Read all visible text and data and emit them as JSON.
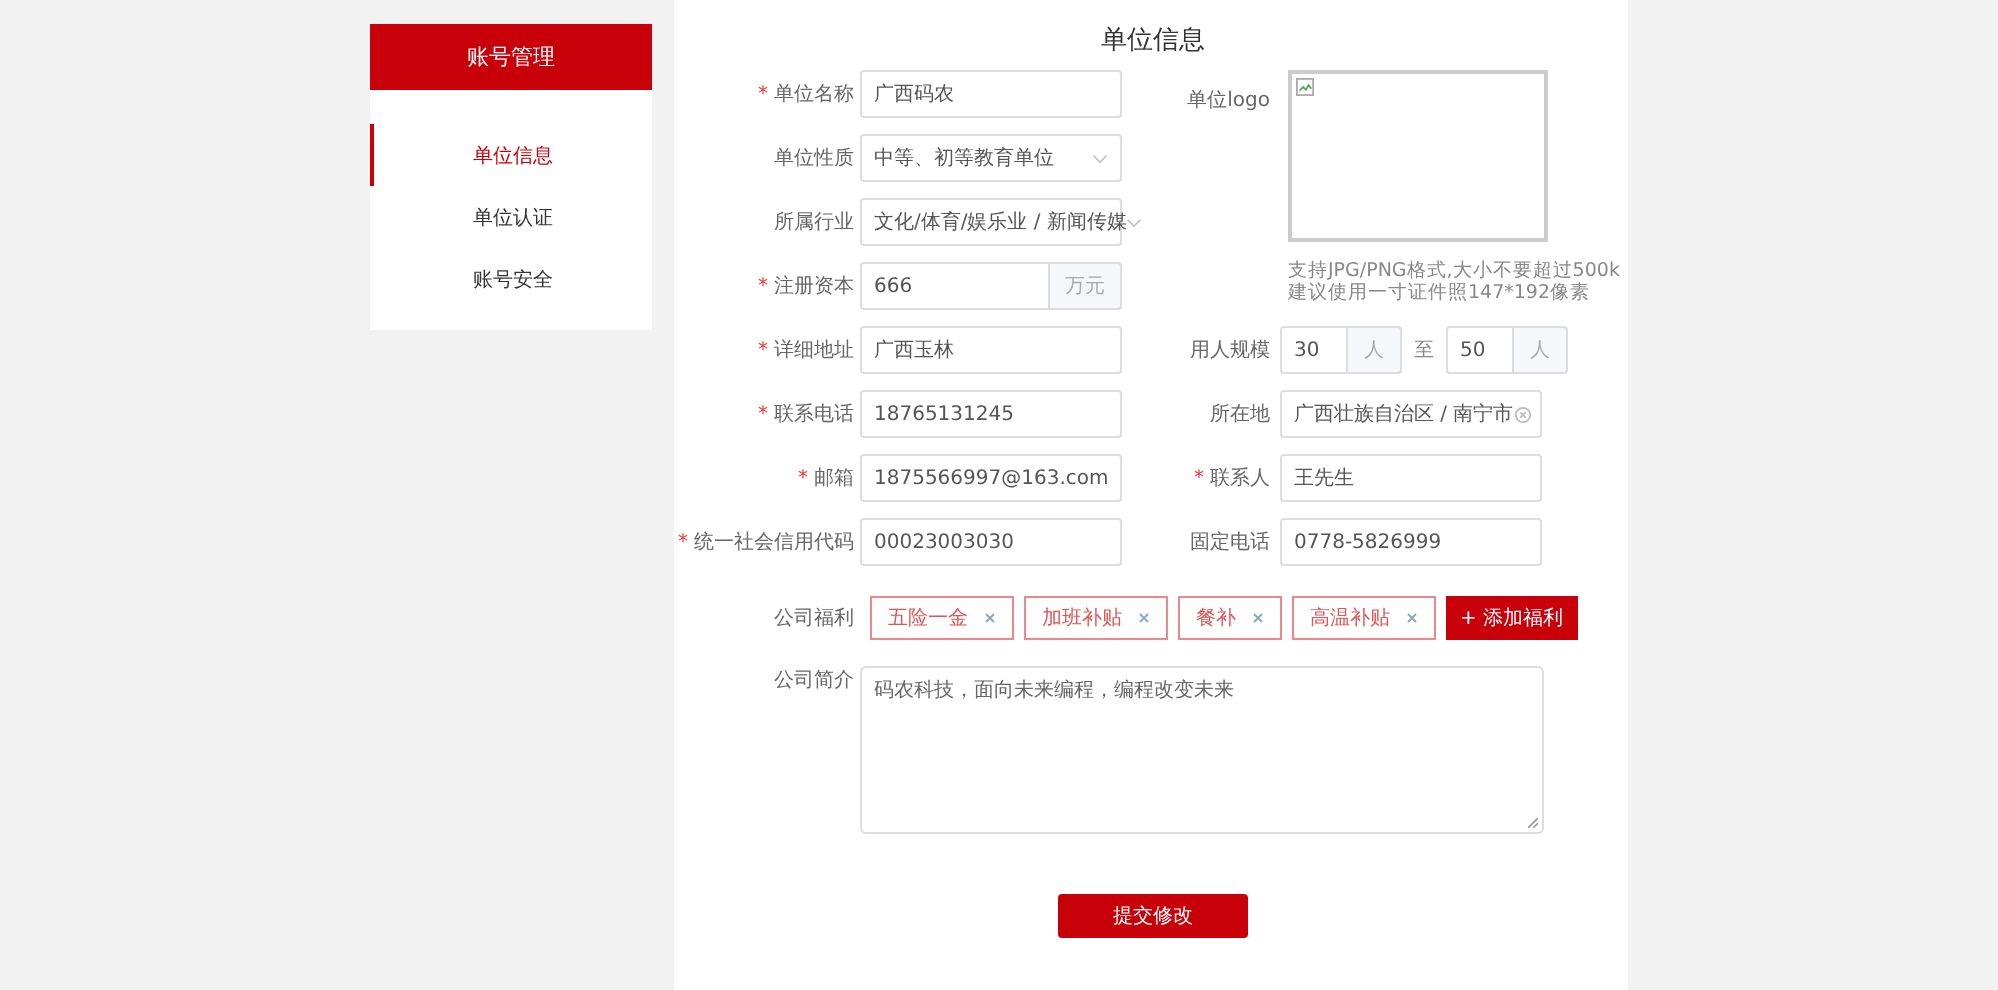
{
  "sidebar": {
    "title": "账号管理",
    "items": [
      {
        "label": "单位信息",
        "selected": true
      },
      {
        "label": "单位认证",
        "selected": false
      },
      {
        "label": "账号安全",
        "selected": false
      }
    ]
  },
  "form": {
    "title": "单位信息",
    "left_fields": [
      {
        "kind": "text",
        "required_mark": "*",
        "label": "单位名称",
        "value": "广西码农"
      },
      {
        "kind": "select",
        "label": "单位性质",
        "value": "中等、初等教育单位"
      },
      {
        "kind": "select",
        "label": "所属行业",
        "value": "文化/体育/娱乐业 / 新闻传媒"
      },
      {
        "kind": "addon",
        "required_mark": "*",
        "label": "注册资本",
        "value": "666",
        "addon": "万元"
      },
      {
        "kind": "text",
        "required_mark": "*",
        "label": "详细地址",
        "value": "广西玉林"
      },
      {
        "kind": "text",
        "required_mark": "*",
        "label": "联系电话",
        "value": "18765131245"
      },
      {
        "kind": "text",
        "required_mark": "*",
        "label": "邮箱",
        "value": "1875566997@163.com"
      },
      {
        "kind": "text",
        "required_mark": "*",
        "label": "统一社会信用代码",
        "value": "00023003030"
      }
    ],
    "logo": {
      "label": "单位logo",
      "hint_lines": [
        "支持JPG/PNG格式,大小不要超过500k",
        "建议使用一寸证件照147*192像素"
      ]
    },
    "headcount": {
      "label": "用人规模",
      "min": "30",
      "min_unit": "人",
      "separator": "至",
      "max": "50",
      "max_unit": "人"
    },
    "right_fields": [
      {
        "kind": "clearable",
        "label": "所在地",
        "value": "广西壮族自治区 / 南宁市"
      },
      {
        "kind": "text",
        "required_mark": "*",
        "label": "联系人",
        "value": "王先生"
      },
      {
        "kind": "text",
        "label": "固定电话",
        "value": "0778-5826999"
      }
    ],
    "welfare": {
      "label": "公司福利",
      "tags": [
        "五险一金",
        "加班补贴",
        "餐补",
        "高温补贴"
      ],
      "add_button": "+ 添加福利"
    },
    "intro": {
      "label": "公司简介",
      "value": "码农科技，面向未来编程，编程改变未来"
    },
    "submit": "提交修改"
  }
}
